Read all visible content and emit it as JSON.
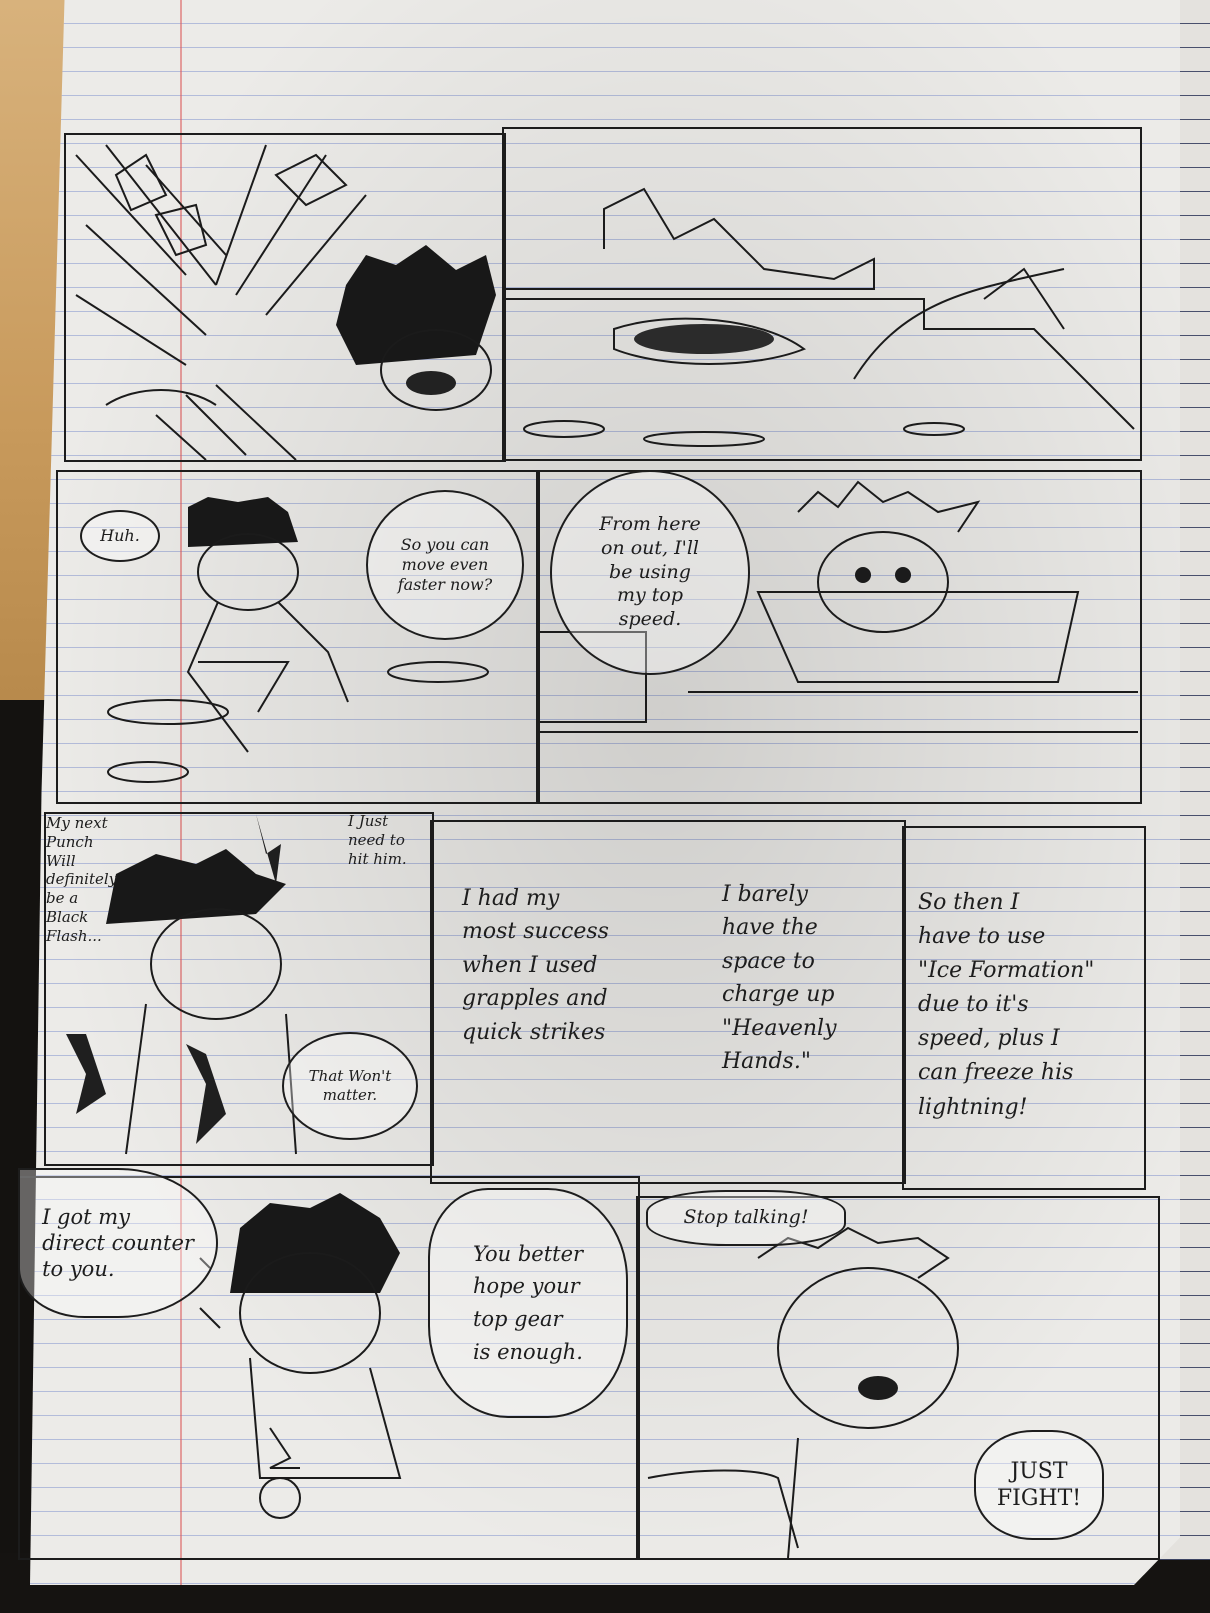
{
  "page": {
    "row2": {
      "huh": "Huh.",
      "faster": "So you can\nmove even\nfaster now?",
      "topspeed": "From here\non out, I'll\nbe using\nmy top\nspeed."
    },
    "row3": {
      "next_punch": "My next\nPunch\nWill\ndefinitely\nbe a\nBlack\nFlash...",
      "hit_him": "I Just\nneed to\nhit him.",
      "wont_matter": "That Won't\nmatter.",
      "success": "I had my\nmost success\nwhen I used\ngrapples and\nquick strikes",
      "barely": "I barely\nhave the\nspace to\ncharge up\n\"Heavenly\nHands.\"",
      "ice": "So then I\nhave to use\n\"Ice Formation\"\ndue to it's\nspeed, plus I\ncan freeze his\nlightning!"
    },
    "row4": {
      "counter": "I got my\ndirect counter\nto you.",
      "hope": "You better\nhope your\ntop gear\nis enough.",
      "stop": "Stop talking!",
      "fight": "JUST\nFIGHT!"
    }
  }
}
